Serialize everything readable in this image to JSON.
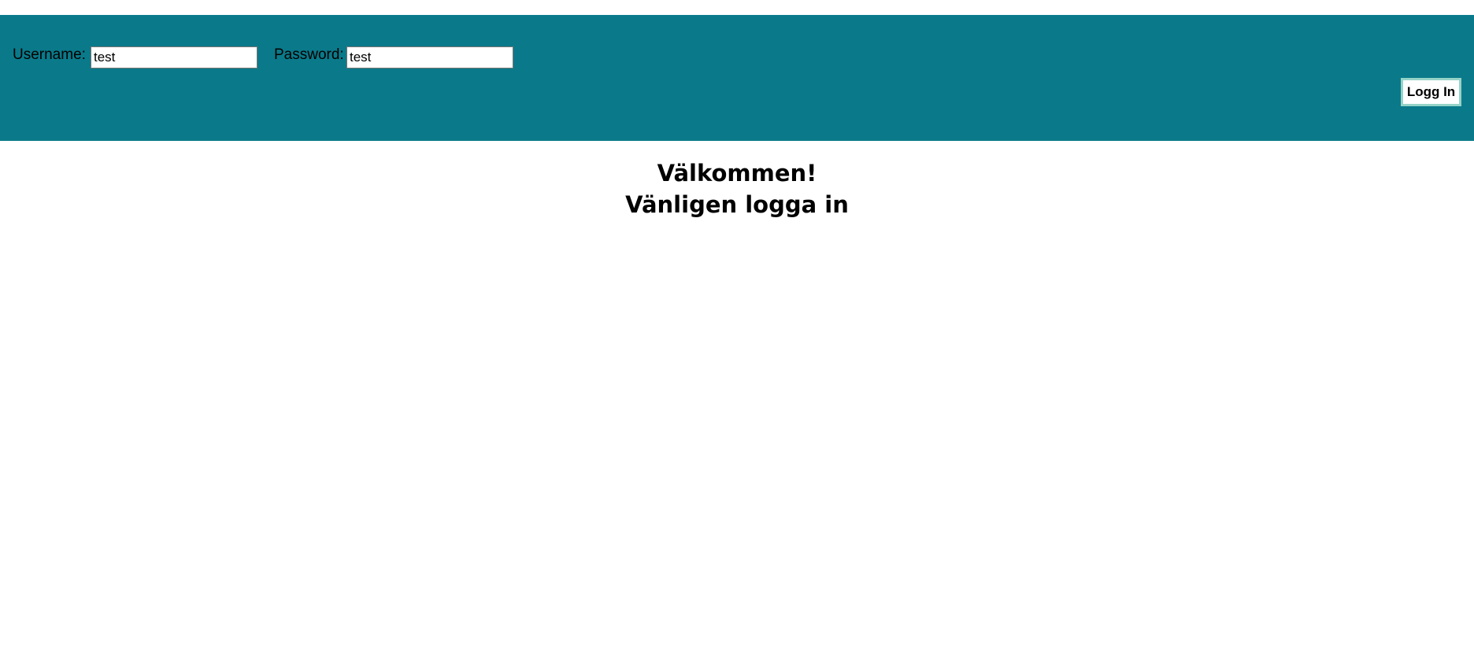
{
  "login": {
    "username_label": "Username:",
    "username_value": "test",
    "password_label": "Password:",
    "password_value": "test",
    "submit_label": "Logg In"
  },
  "main": {
    "welcome": "Välkommen!",
    "prompt": "Vänligen logga in"
  },
  "colors": {
    "header_bg": "#0a7a8a"
  }
}
